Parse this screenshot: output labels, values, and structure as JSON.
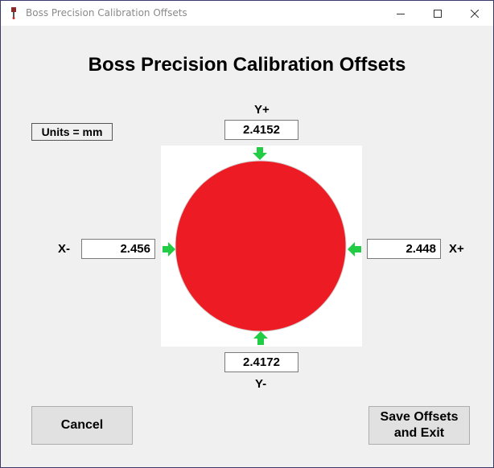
{
  "window": {
    "title": "Boss Precision Calibration Offsets",
    "icons": {
      "app": "probe-icon",
      "minimize": "minimize-icon",
      "maximize": "maximize-icon",
      "close": "close-icon"
    }
  },
  "heading": "Boss Precision Calibration Offsets",
  "units_label": "Units = mm",
  "axes": {
    "y_plus": {
      "label": "Y+",
      "value": "2.4152"
    },
    "y_minus": {
      "label": "Y-",
      "value": "2.4172"
    },
    "x_minus": {
      "label": "X-",
      "value": "2.456"
    },
    "x_plus": {
      "label": "X+",
      "value": "2.448"
    }
  },
  "diagram": {
    "circle_color": "#ed1c24",
    "arrow_color": "#22cc44",
    "arrow_icon": "green-arrow-icon"
  },
  "buttons": {
    "cancel": "Cancel",
    "save_line1": "Save Offsets",
    "save_line2": "and Exit"
  }
}
